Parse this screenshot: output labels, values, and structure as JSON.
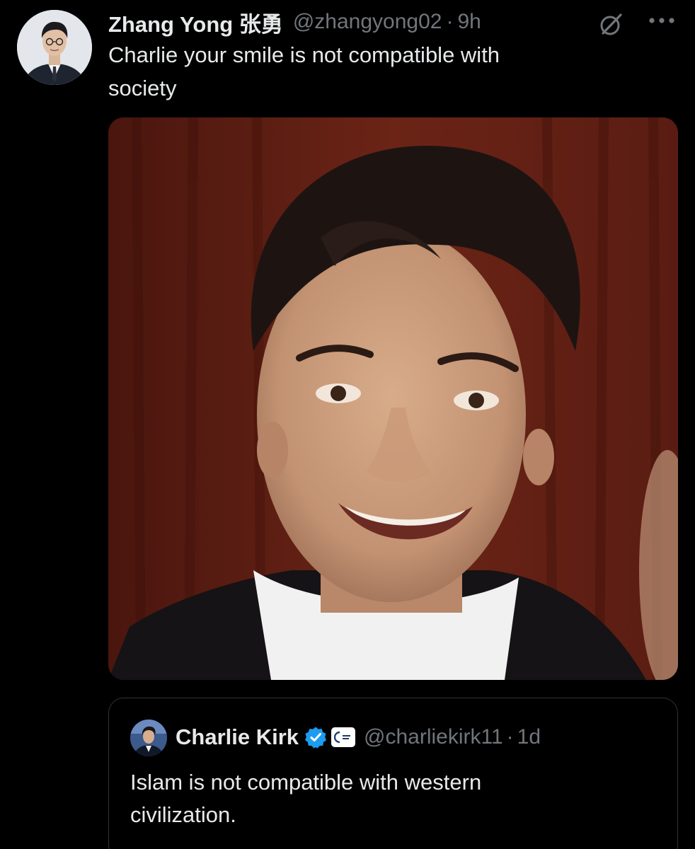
{
  "tweet": {
    "author": {
      "display_name": "Zhang Yong 张勇",
      "handle": "@zhangyong02",
      "separator": "·",
      "time": "9h"
    },
    "text_line1": "Charlie your smile is not compatible with",
    "text_line2": "society",
    "icons": {
      "grok": "grok-slash-circle-icon",
      "more": "more-horizontal-icon"
    },
    "media": {
      "subject": "photo"
    }
  },
  "quoted_tweet": {
    "author": {
      "display_name": "Charlie Kirk",
      "verified": true,
      "handle": "@charliekirk11",
      "separator": "·",
      "time": "1d"
    },
    "text_line1": "Islam is not compatible with western",
    "text_line2": "civilization."
  },
  "colors": {
    "background": "#000000",
    "text_primary": "#e7e9ea",
    "text_secondary": "#71767b",
    "verified_blue": "#1d9bf0",
    "card_border": "#2f3336"
  }
}
